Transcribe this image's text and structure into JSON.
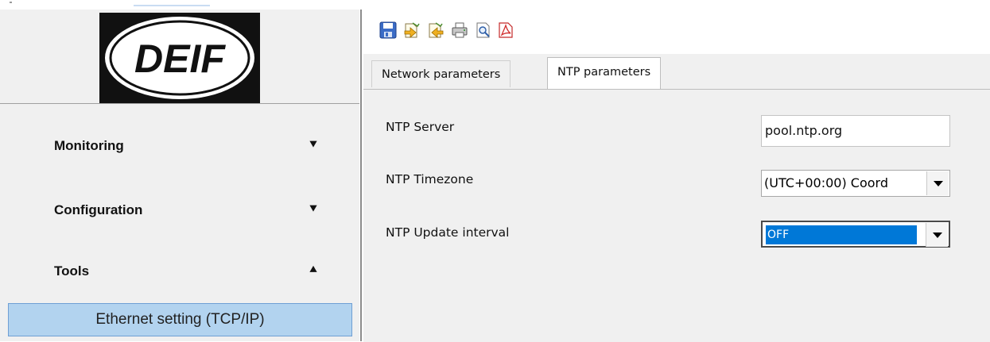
{
  "brand": {
    "logo_text": "DEIF"
  },
  "sidebar": {
    "items": [
      {
        "label": "Monitoring",
        "chevron": "»",
        "state": "collapsed"
      },
      {
        "label": "Configuration",
        "chevron": "»",
        "state": "collapsed"
      },
      {
        "label": "Tools",
        "chevron": "«",
        "state": "expanded"
      }
    ],
    "sub_items": [
      {
        "label": "Ethernet setting (TCP/IP)",
        "selected": true
      }
    ]
  },
  "toolbar": {
    "icons": [
      "save-icon",
      "import-icon",
      "export-icon",
      "print-icon",
      "print-preview-icon",
      "pdf-icon"
    ]
  },
  "tabs": [
    {
      "label": "Network parameters",
      "active": false
    },
    {
      "label": "NTP parameters",
      "active": true
    }
  ],
  "form": {
    "ntp_server": {
      "label": "NTP Server",
      "value": "pool.ntp.org"
    },
    "ntp_timezone": {
      "label": "NTP Timezone",
      "value": "(UTC+00:00) Coord"
    },
    "ntp_update_interval": {
      "label": "NTP Update interval",
      "value": "OFF"
    }
  },
  "colors": {
    "selection": "#0078d7",
    "sub_item_bg": "#b2d3ef",
    "panel_bg": "#f0f0f0"
  }
}
